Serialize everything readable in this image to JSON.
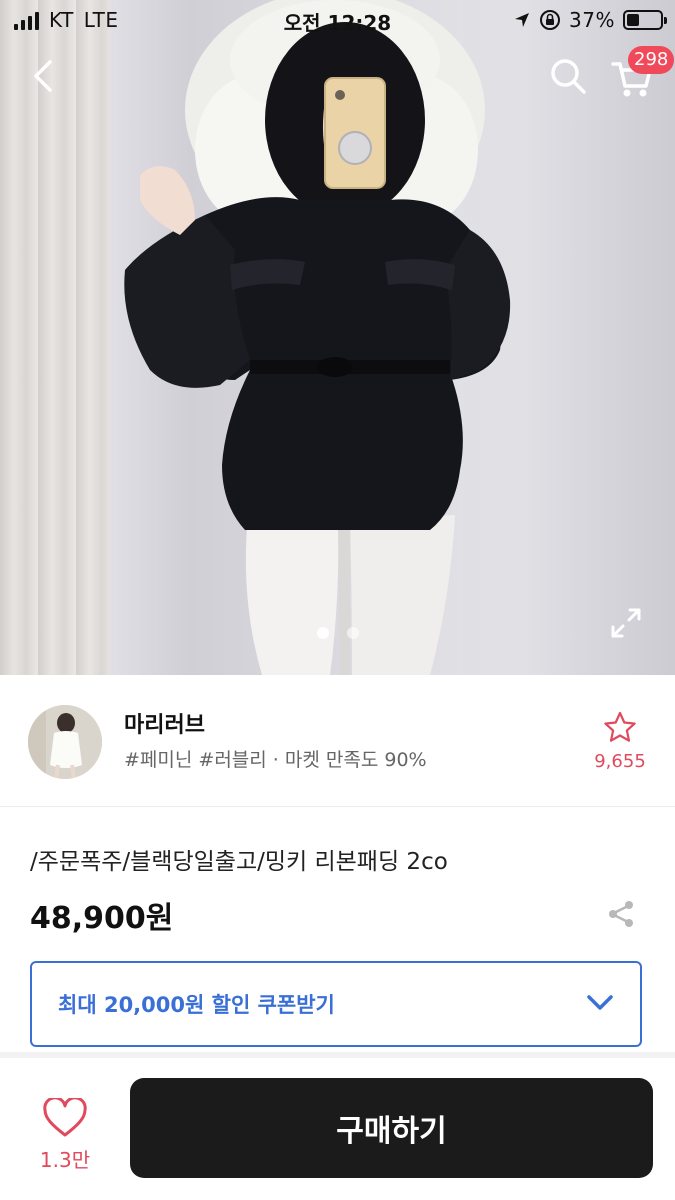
{
  "status_bar": {
    "carrier": "KT",
    "network": "LTE",
    "time": "오전 12:28",
    "battery": "37%",
    "battery_level": 0.37
  },
  "header": {
    "cart_count": "298"
  },
  "gallery": {
    "total": 2,
    "active_index": 0
  },
  "seller": {
    "name": "마리러브",
    "tags": "#페미닌 #러블리 · 마켓 만족도 90%",
    "favorite_count": "9,655"
  },
  "product": {
    "title": "/주문폭주/블랙당일출고/밍키 리본패딩 2co",
    "price": "48,900원"
  },
  "coupon": {
    "label": "최대 20,000원 할인 쿠폰받기"
  },
  "bottom_bar": {
    "like_count": "1.3만",
    "buy_label": "구매하기"
  },
  "colors": {
    "accent_red": "#e04a5c",
    "coupon_blue": "#3a6fd6",
    "buy_button": "#1b1b1b",
    "badge": "#f04a5a"
  },
  "icons": {
    "back": "chevron-left-icon",
    "search": "search-icon",
    "cart": "cart-icon",
    "expand": "expand-icon",
    "star": "star-icon",
    "share": "share-icon",
    "chevron": "chevron-down-icon",
    "heart": "heart-icon"
  }
}
